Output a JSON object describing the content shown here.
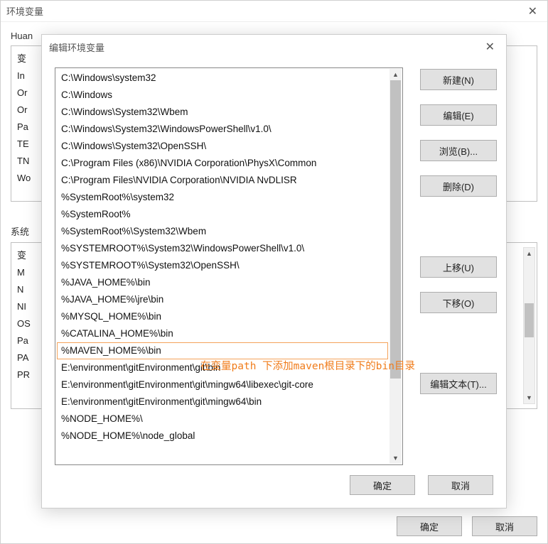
{
  "outer": {
    "title": "环境变量",
    "user_section_label": "Huan",
    "sys_section_label": "系统",
    "user_vars_visible": [
      "变",
      "In",
      "Or",
      "Or",
      "Pa",
      "TE",
      "TN",
      "Wo"
    ],
    "sys_vars_visible": [
      "变",
      "M",
      "N",
      "NI",
      "OS",
      "Pa",
      "PA",
      "PR"
    ],
    "buttons": {
      "ok": "确定",
      "cancel": "取消"
    }
  },
  "inner": {
    "title": "编辑环境变量",
    "path_items": [
      "C:\\Windows\\system32",
      "C:\\Windows",
      "C:\\Windows\\System32\\Wbem",
      "C:\\Windows\\System32\\WindowsPowerShell\\v1.0\\",
      "C:\\Windows\\System32\\OpenSSH\\",
      "C:\\Program Files (x86)\\NVIDIA Corporation\\PhysX\\Common",
      "C:\\Program Files\\NVIDIA Corporation\\NVIDIA NvDLISR",
      "%SystemRoot%\\system32",
      "%SystemRoot%",
      "%SystemRoot%\\System32\\Wbem",
      "%SYSTEMROOT%\\System32\\WindowsPowerShell\\v1.0\\",
      "%SYSTEMROOT%\\System32\\OpenSSH\\",
      "%JAVA_HOME%\\bin",
      "%JAVA_HOME%\\jre\\bin",
      "%MYSQL_HOME%\\bin",
      "%CATALINA_HOME%\\bin",
      "%MAVEN_HOME%\\bin",
      "E:\\environment\\gitEnvironment\\git\\bin",
      "E:\\environment\\gitEnvironment\\git\\mingw64\\libexec\\git-core",
      "E:\\environment\\gitEnvironment\\git\\mingw64\\bin",
      "%NODE_HOME%\\",
      "%NODE_HOME%\\node_global"
    ],
    "highlight_index": 16,
    "buttons": {
      "new": "新建(N)",
      "edit": "编辑(E)",
      "browse": "浏览(B)...",
      "delete": "删除(D)",
      "moveup": "上移(U)",
      "movedown": "下移(O)",
      "edittext": "编辑文本(T)...",
      "ok": "确定",
      "cancel": "取消"
    }
  },
  "annotation": "在变量path 下添加maven根目录下的bin目录"
}
